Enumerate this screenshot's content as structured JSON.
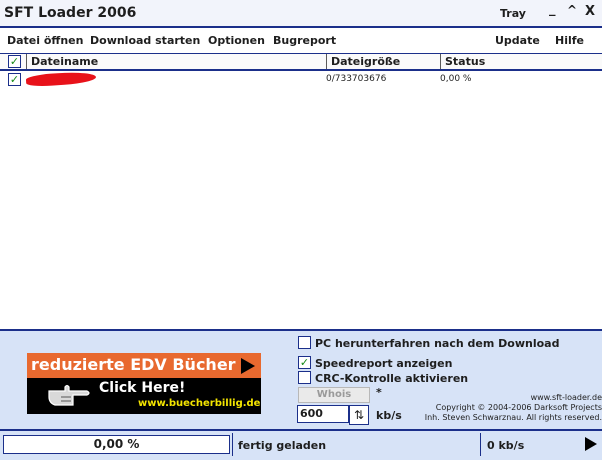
{
  "window": {
    "title": "SFT Loader 2006",
    "tray_label": "Tray",
    "minimize_glyph": "_",
    "maximize_glyph": "^",
    "close_glyph": "X"
  },
  "menu": {
    "open_file": "Datei öffnen",
    "start_download": "Download starten",
    "options": "Optionen",
    "bugreport": "Bugreport",
    "update": "Update",
    "help": "Hilfe"
  },
  "list": {
    "columns": {
      "name": "Dateiname",
      "size": "Dateigröße",
      "status": "Status"
    },
    "header_checked": true,
    "rows": [
      {
        "checked": true,
        "name_redacted": true,
        "size": "0/733703676",
        "status": "0,00 %"
      }
    ]
  },
  "banner": {
    "headline": "reduzierte EDV Bücher",
    "cta": "Click Here!",
    "url": "www.buecherbillig.de",
    "colors": {
      "top": "#e8692f",
      "url": "#f3e400"
    }
  },
  "options": {
    "shutdown": {
      "label": "PC herunterfahren nach dem Download",
      "checked": false
    },
    "speedreport": {
      "label": "Speedreport anzeigen",
      "checked": true
    },
    "crc": {
      "label": "CRC-Kontrolle aktivieren",
      "checked": false
    },
    "whois_label": "Whois",
    "asterisk": "*",
    "speed_value": "600",
    "speed_unit": "kb/s"
  },
  "credits": {
    "website": "www.sft-loader.de",
    "copyright": "Copyright © 2004-2006  Darksoft Projects",
    "owner": "Inh. Steven Schwarznau. All rights reserved."
  },
  "statusbar": {
    "progress_text": "0,00 %",
    "progress_fraction": 0,
    "status": "fertig geladen",
    "speed": "0 kb/s"
  },
  "colors": {
    "accent": "#1b2f8a",
    "panel": "#d7e3f7",
    "check": "#168a16"
  }
}
